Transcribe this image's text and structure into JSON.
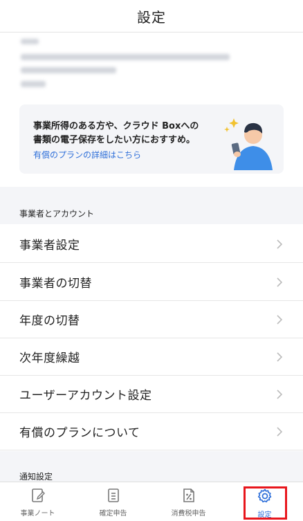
{
  "header": {
    "title": "設定"
  },
  "promo": {
    "line1": "事業所得のある方や、クラウド Boxへの",
    "line2": "書類の電子保存をしたい方におすすめ。",
    "link": "有償のプランの詳細はこちら"
  },
  "sections": {
    "account_header": "事業者とアカウント",
    "notification_header": "通知設定"
  },
  "menu": {
    "items": [
      {
        "label": "事業者設定"
      },
      {
        "label": "事業者の切替"
      },
      {
        "label": "年度の切替"
      },
      {
        "label": "次年度繰越"
      },
      {
        "label": "ユーザーアカウント設定"
      },
      {
        "label": "有償のプランについて"
      }
    ]
  },
  "tabbar": {
    "tabs": [
      {
        "label": "事業ノート",
        "icon": "note-edit-icon"
      },
      {
        "label": "確定申告",
        "icon": "document-icon"
      },
      {
        "label": "消費税申告",
        "icon": "tax-percent-icon"
      },
      {
        "label": "設定",
        "icon": "gear-icon"
      }
    ],
    "active_color": "#2e6fd9",
    "highlight_color": "#e8161c"
  }
}
